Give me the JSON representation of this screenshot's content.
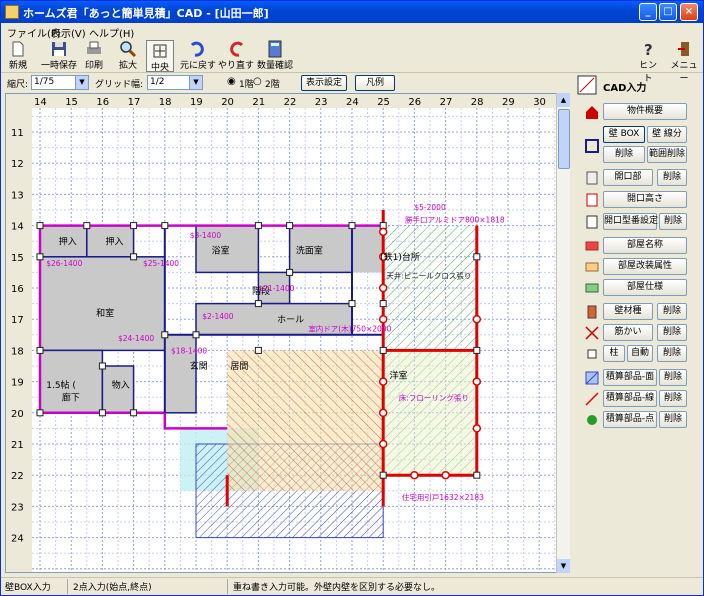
{
  "window": {
    "title": "ホームズ君「あっと簡単見積」CAD - [山田一郎]"
  },
  "menu": [
    "ファイル(F)",
    "表示(V)",
    "ヘルプ(H)"
  ],
  "toolbar": {
    "new": "新規",
    "save": "一時保存",
    "print": "印刷",
    "zoom": "拡大",
    "center": "中央",
    "undo": "元に戻す",
    "redo": "やり直す",
    "quantity": "数量確認",
    "hint": "ヒント",
    "menu": "メニュー"
  },
  "options": {
    "scale_label": "縮尺:",
    "scale_value": "1/75",
    "grid_label": "グリッド幅:",
    "grid_value": "1/2",
    "floor1": "1階",
    "floor2": "2階",
    "display_settings": "表示設定",
    "legend": "凡例"
  },
  "ruler": {
    "cols": [
      "14",
      "15",
      "16",
      "17",
      "18",
      "19",
      "20",
      "21",
      "22",
      "23",
      "24",
      "25",
      "26",
      "27",
      "28",
      "29",
      "30"
    ],
    "rows": [
      "11",
      "12",
      "13",
      "14",
      "15",
      "16",
      "17",
      "18",
      "19",
      "20",
      "21",
      "22",
      "23",
      "24"
    ]
  },
  "plan": {
    "rooms": [
      {
        "label": "押入"
      },
      {
        "label": "押入"
      },
      {
        "label": "和室"
      },
      {
        "label": "1.5帖 ("
      },
      {
        "label": "廊下"
      },
      {
        "label": "物入"
      },
      {
        "label": "玄関"
      },
      {
        "label": "浴室"
      },
      {
        "label": "洗面室"
      },
      {
        "label": "階段"
      },
      {
        "label": "ホール"
      },
      {
        "label": "居間"
      },
      {
        "label": "(鉄1)台所"
      },
      {
        "label": "洋室"
      }
    ],
    "annotations": [
      "$5-2000",
      "勝手口アルミドア800×1818",
      "天井:ビニールクロス張り",
      "床:フローリング張り",
      "住宅用引戸1632×2183",
      "室内ドア(木)750×2000",
      "$21-1400",
      "$26-1400",
      "$25-1400",
      "$24-1400",
      "$18-1400",
      "$2-1400",
      "$3-1400"
    ]
  },
  "panel": {
    "title": "CAD入力",
    "property": "物件概要",
    "wall_box": "壁 BOX",
    "wall_line": "壁 線分",
    "delete": "削除",
    "range_delete": "範囲削除",
    "opening": "開口部",
    "opening_height": "開口高さ",
    "opening_type": "開口型番設定",
    "room_name": "部屋名称",
    "room_extra": "部屋改装属性",
    "room_spec": "部屋仕様",
    "wall_material": "壁材種",
    "reinforce": "筋かい",
    "column": "柱",
    "auto": "自動",
    "est_face": "積算部品-面",
    "est_line": "積算部品-線",
    "est_point": "積算部品-点"
  },
  "status": {
    "mode": "壁BOX入力",
    "hint": "2点入力(始点,終点)",
    "message": "重ね書き入力可能。外壁内壁を区別する必要なし。"
  },
  "colors": {
    "wall": "#1a1a8c",
    "outer": "#cc00cc",
    "red": "#e00000",
    "hatch": "#3a48c8",
    "room": "#c9c9c9",
    "green": "#4caf50"
  }
}
